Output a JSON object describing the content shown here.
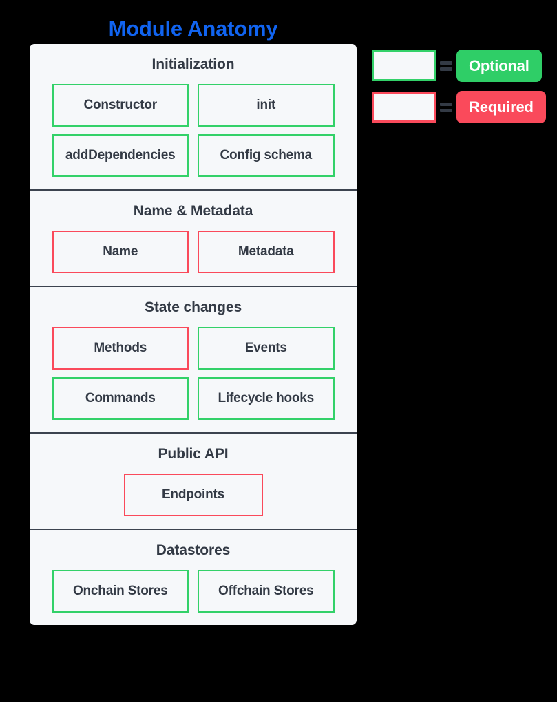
{
  "title": "Module Anatomy",
  "colors": {
    "title": "#1164F0",
    "optional": "#33D169",
    "required": "#FA4A5B",
    "card_bg": "#F6F8FA",
    "text": "#333A45",
    "page_bg": "#000000",
    "divider": "#3C434F"
  },
  "legend": {
    "rows": [
      {
        "swatch_kind": "optional",
        "equals": "=",
        "label": "Optional"
      },
      {
        "swatch_kind": "required",
        "equals": "=",
        "label": "Required"
      }
    ]
  },
  "sections": [
    {
      "title": "Initialization",
      "items": [
        {
          "label": "Constructor",
          "kind": "optional"
        },
        {
          "label": "init",
          "kind": "optional"
        },
        {
          "label": "addDependencies",
          "kind": "optional"
        },
        {
          "label": "Config schema",
          "kind": "optional"
        }
      ]
    },
    {
      "title": "Name & Metadata",
      "items": [
        {
          "label": "Name",
          "kind": "required"
        },
        {
          "label": "Metadata",
          "kind": "required"
        }
      ]
    },
    {
      "title": "State changes",
      "items": [
        {
          "label": "Methods",
          "kind": "required"
        },
        {
          "label": "Events",
          "kind": "optional"
        },
        {
          "label": "Commands",
          "kind": "optional"
        },
        {
          "label": "Lifecycle hooks",
          "kind": "optional"
        }
      ]
    },
    {
      "title": "Public API",
      "items": [
        {
          "label": "Endpoints",
          "kind": "required"
        }
      ]
    },
    {
      "title": "Datastores",
      "items": [
        {
          "label": "Onchain Stores",
          "kind": "optional"
        },
        {
          "label": "Offchain Stores",
          "kind": "optional"
        }
      ]
    }
  ]
}
